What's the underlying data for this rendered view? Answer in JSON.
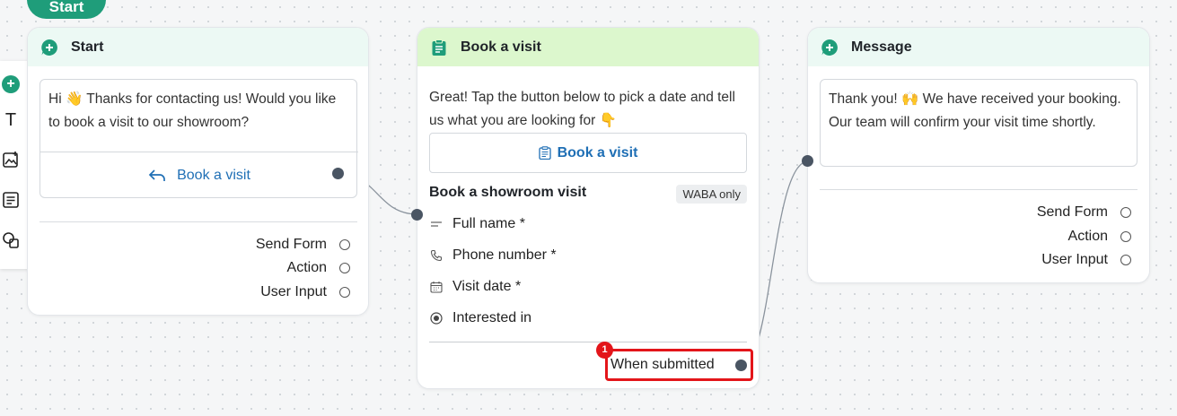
{
  "start_pill": {
    "label": "Start"
  },
  "toolbar": {
    "items": [
      {
        "icon": "plus-circle-icon"
      },
      {
        "icon": "text-icon",
        "glyph": "T"
      },
      {
        "icon": "image-add-icon"
      },
      {
        "icon": "document-icon"
      },
      {
        "icon": "shapes-icon"
      }
    ]
  },
  "start_node": {
    "title": "Start",
    "message": "Hi 👋 Thanks for contacting us! Would you like to book a visit to our showroom?",
    "quick_reply": "Book a visit",
    "options": [
      "Send Form",
      "Action",
      "User Input"
    ]
  },
  "book_node": {
    "title": "Book a visit",
    "message": "Great! Tap the button below to pick a date and tell us what you are looking for 👇",
    "button_label": "Book a visit",
    "form_title": "Book a showroom visit",
    "badge": "WABA only",
    "fields": [
      {
        "label": "Full name *",
        "icon": "short-text-icon"
      },
      {
        "label": "Phone number *",
        "icon": "phone-icon"
      },
      {
        "label": "Visit date *",
        "icon": "calendar-icon"
      },
      {
        "label": "Interested in",
        "icon": "radio-icon"
      }
    ],
    "output_label": "When submitted",
    "marker": "1"
  },
  "message_node": {
    "title": "Message",
    "message": "Thank you! 🙌 We have received your booking. Our team will confirm your visit time shortly.",
    "options": [
      "Send Form",
      "Action",
      "User Input"
    ]
  },
  "colors": {
    "accent": "#1f9d7a",
    "link": "#1f6fb5",
    "highlight": "#e3151a",
    "header_mint": "#ecf9f4",
    "header_green": "#dcf7cd"
  }
}
